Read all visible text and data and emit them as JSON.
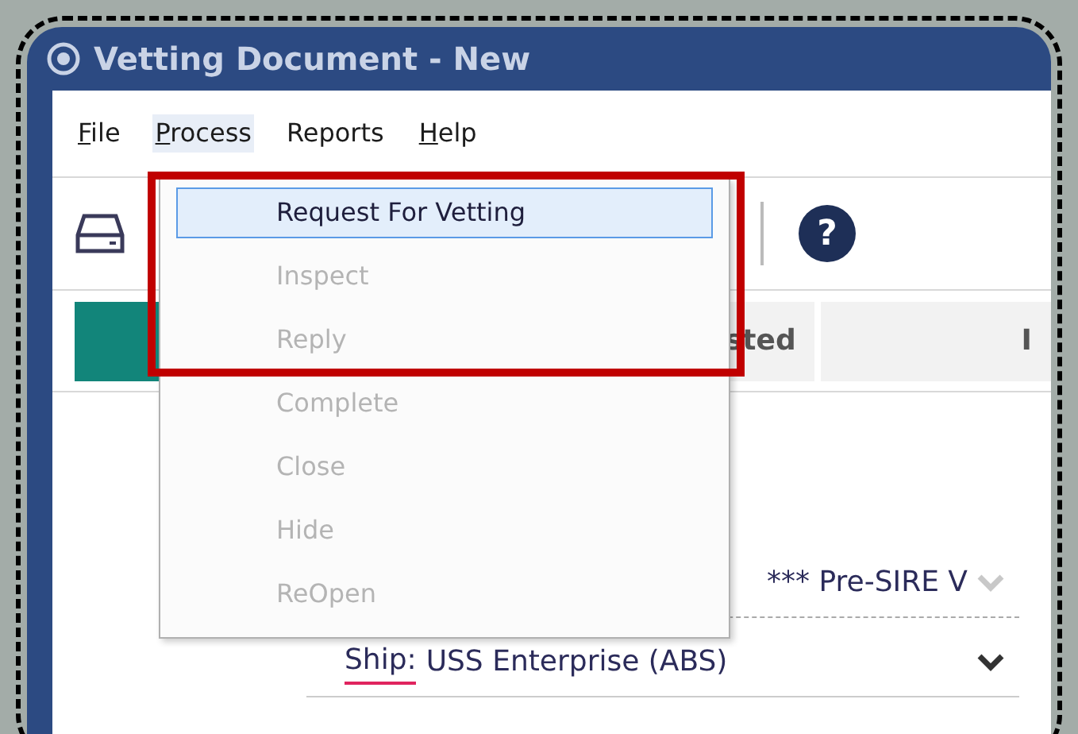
{
  "window": {
    "title": "Vetting Document - New"
  },
  "menu": [
    {
      "label": "File",
      "underline_first": true,
      "selected": false
    },
    {
      "label": "Process",
      "underline_first": true,
      "selected": true
    },
    {
      "label": "Reports",
      "underline_first": false,
      "selected": false
    },
    {
      "label": "Help",
      "underline_first": true,
      "selected": false
    }
  ],
  "dropdown": [
    {
      "label": "Request For Vetting",
      "disabled": false,
      "selected": true
    },
    {
      "label": "Inspect",
      "disabled": true,
      "selected": false
    },
    {
      "label": "Reply",
      "disabled": true,
      "selected": false
    },
    {
      "label": "Complete",
      "disabled": true,
      "selected": false
    },
    {
      "label": "Close",
      "disabled": true,
      "selected": false
    },
    {
      "label": "Hide",
      "disabled": true,
      "selected": false
    },
    {
      "label": "ReOpen",
      "disabled": true,
      "selected": false
    }
  ],
  "toolbar": {
    "help_icon": "?"
  },
  "steps": [
    {
      "selected": true
    },
    {
      "label": "sted",
      "selected": false
    },
    {
      "label": "I",
      "selected": false
    }
  ],
  "fields": [
    {
      "value": "*** Pre-SIRE V",
      "disabled": true
    },
    {
      "label": "Ship:",
      "value": "USS Enterprise (ABS)",
      "required": true,
      "disabled": false
    }
  ]
}
